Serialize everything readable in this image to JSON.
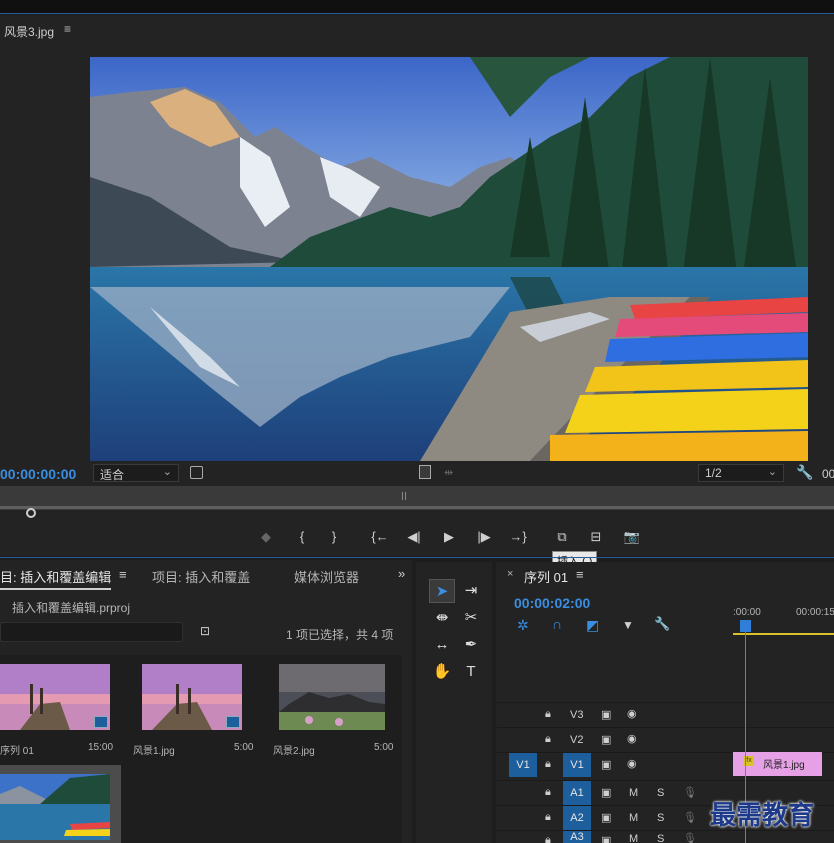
{
  "source_monitor": {
    "title": "风景3.jpg",
    "menu_glyph": "≡",
    "timecode": "00:00:00:00",
    "fit_label": "适合",
    "resolution_label": "1/2",
    "right_timecode_partial": "00",
    "insert_tooltip": "插入 (,)"
  },
  "project_panel": {
    "tab_active": "目: 插入和覆盖编辑",
    "tab_menu": "≡",
    "tab_project2": "项目: 插入和覆盖",
    "tab_media": "媒体浏览器",
    "more_tabs": "»",
    "file_name": "插入和覆盖编辑.prproj",
    "selection_status": "1 项已选择，共 4 项",
    "items": [
      {
        "name": "序列 01",
        "duration": "15:00"
      },
      {
        "name": "风景1.jpg",
        "duration": "5:00"
      },
      {
        "name": "风景2.jpg",
        "duration": "5:00"
      },
      {
        "name": "",
        "duration": ""
      }
    ]
  },
  "timeline": {
    "close_glyph": "×",
    "sequence_tab": "序列 01",
    "menu_glyph": "≡",
    "timecode": "00:00:02:00",
    "ruler_start": ":00:00",
    "ruler_next": "00:00:15",
    "tracks": [
      {
        "label": "V3",
        "src": ""
      },
      {
        "label": "V2",
        "src": ""
      },
      {
        "label": "V1",
        "src": "V1"
      },
      {
        "label": "A1",
        "src": "",
        "m": "M",
        "s": "S"
      },
      {
        "label": "A2",
        "src": "",
        "m": "M",
        "s": "S"
      },
      {
        "label": "A3",
        "src": "",
        "m": "M",
        "s": "S"
      }
    ],
    "clip_label": "风景1.jpg",
    "clip_fx": "fx"
  },
  "watermark": "最需教育",
  "colors": {
    "accent_blue": "#3a8de0",
    "clip_pink": "#e6a0e6",
    "ruler_yellow": "#d8c32a"
  }
}
